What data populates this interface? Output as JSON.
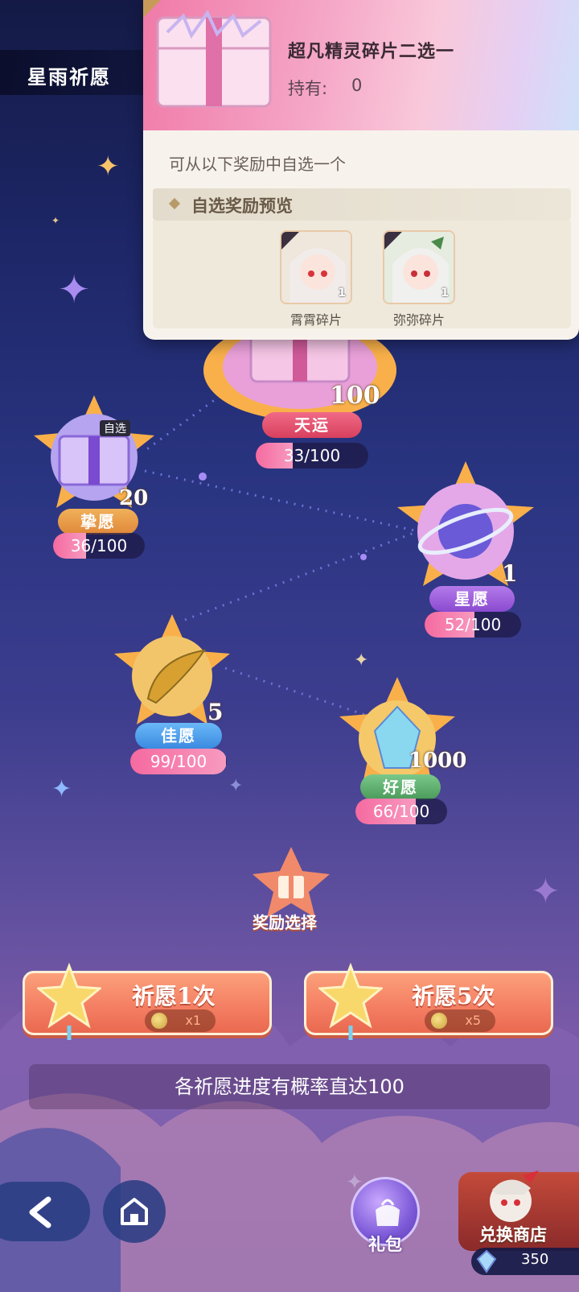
{
  "header": {
    "title": "星雨祈愿"
  },
  "popup": {
    "item_name": "超凡精灵碎片二选一",
    "owned_label": "持有:",
    "owned_value": "0",
    "description": "可从以下奖励中自选一个",
    "preview_title": "自选奖励预览",
    "rewards": [
      {
        "label": "霄霄碎片",
        "count": "1"
      },
      {
        "label": "弥弥碎片",
        "count": "1"
      }
    ]
  },
  "nodes": {
    "tianyun": {
      "name": "天运",
      "count": "100",
      "progress": "33/100",
      "progress_value": 33,
      "max": 100
    },
    "zhiyuan": {
      "name": "挚愿",
      "count": "20",
      "progress": "36/100",
      "progress_value": 36,
      "max": 100,
      "badge": "自选"
    },
    "xingyuan": {
      "name": "星愿",
      "count": "1",
      "progress": "52/100",
      "progress_value": 52,
      "max": 100
    },
    "jiayuan": {
      "name": "佳愿",
      "count": "5",
      "progress": "99/100",
      "progress_value": 99,
      "max": 100
    },
    "haoyuan": {
      "name": "好愿",
      "count": "1000",
      "progress": "66/100",
      "progress_value": 66,
      "max": 100
    }
  },
  "reward_select": {
    "label": "奖励选择"
  },
  "actions": {
    "wish1": {
      "label": "祈愿1次",
      "cost": "x1"
    },
    "wish5": {
      "label": "祈愿5次",
      "cost": "x5"
    }
  },
  "hint": "各祈愿进度有概率直达100",
  "bottom": {
    "gift_label": "礼包",
    "shop_label": "兑换商店",
    "currency_value": "350"
  },
  "colors": {
    "accent_pink": "#f56aa0",
    "button_orange": "#f47d62",
    "tianyun_tag": "#e0506a",
    "zhiyuan_tag": "#e99a4a",
    "xingyuan_tag": "#9a5ad8",
    "jiayuan_tag": "#4a9ae8",
    "haoyuan_tag": "#5aa86a"
  }
}
